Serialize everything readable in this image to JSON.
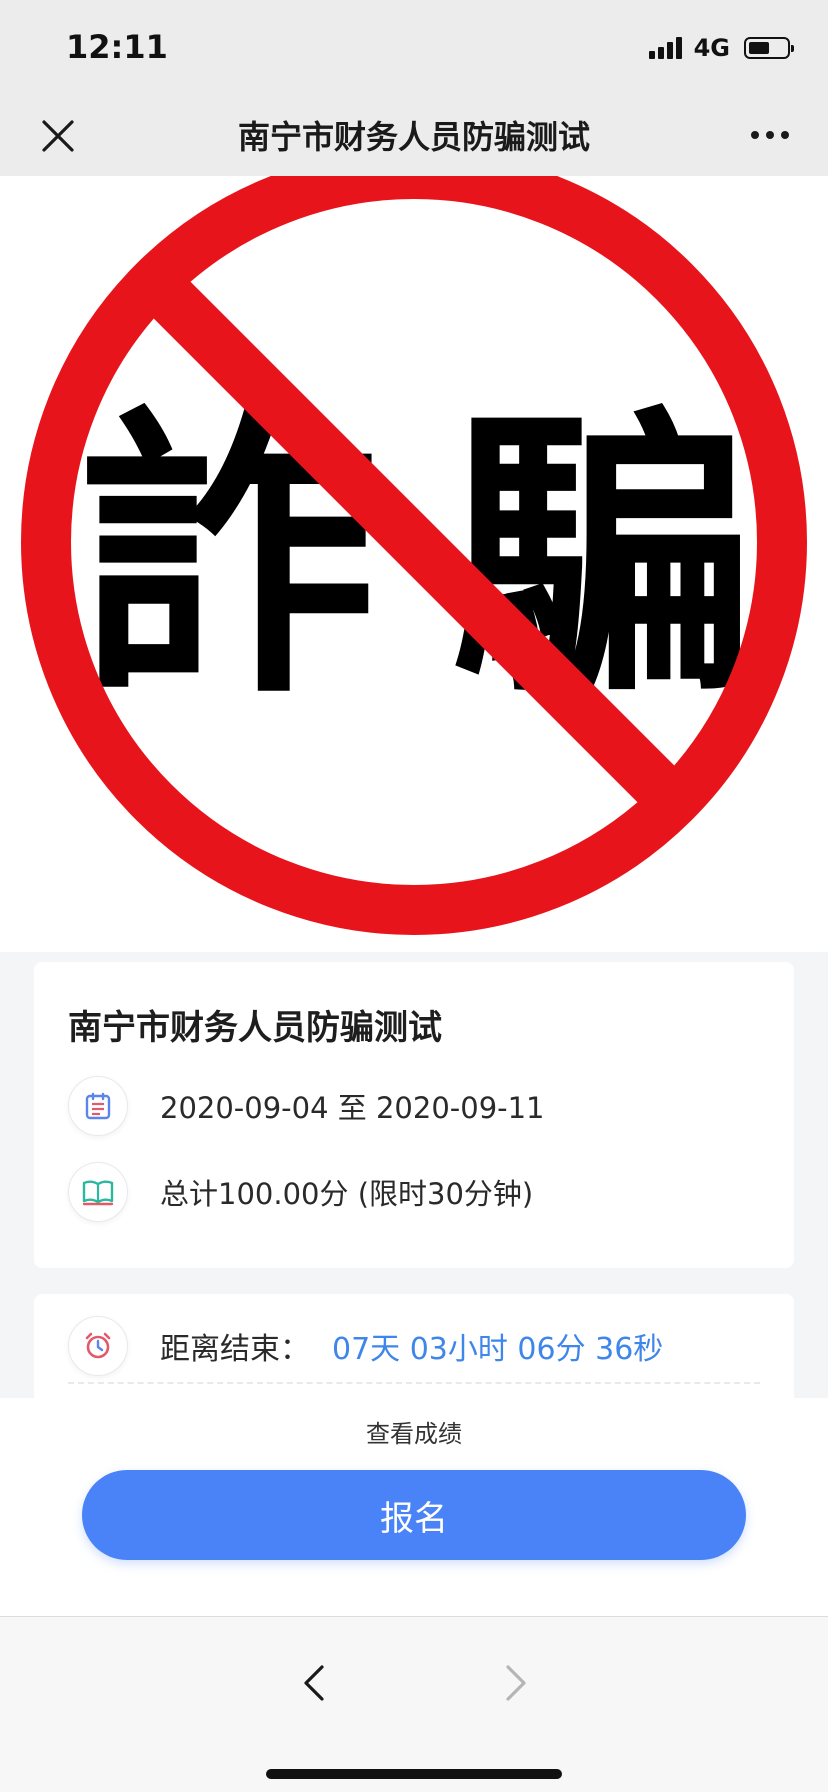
{
  "status_bar": {
    "time": "12:11",
    "network": "4G"
  },
  "nav": {
    "title": "南宁市财务人员防骗测试"
  },
  "banner": {
    "glyphs": [
      "詐",
      "騙"
    ],
    "colors": {
      "ring": "#e8141b",
      "text": "#000000"
    }
  },
  "info": {
    "title": "南宁市财务人员防骗测试",
    "date_range": "2020-09-04 至 2020-09-11",
    "score": "总计100.00分 (限时30分钟)"
  },
  "timer": {
    "label": "距离结束：",
    "value": "07天 03小时 06分 36秒"
  },
  "actions": {
    "view_score": "查看成绩",
    "signup": "报名"
  },
  "colors": {
    "accent": "#4a83f7",
    "timer_text": "#3e86ea"
  },
  "icons": {
    "nav_close": "close-icon",
    "nav_more": "more-icon",
    "date": "calendar-icon",
    "score": "book-icon",
    "timer": "alarm-clock-icon",
    "back": "chevron-left-icon",
    "forward": "chevron-right-icon"
  }
}
